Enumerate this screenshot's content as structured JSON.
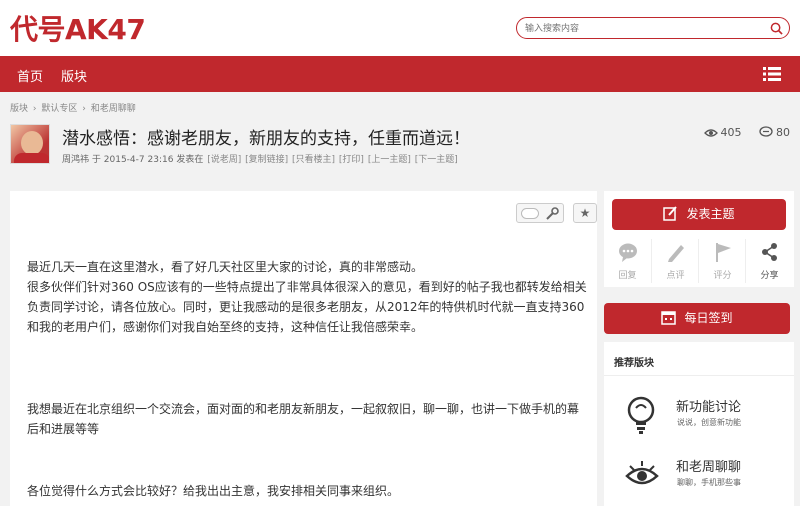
{
  "header": {
    "logo": "代号AK47",
    "search_placeholder": "输入搜索内容"
  },
  "nav": {
    "items": [
      "首页",
      "版块"
    ]
  },
  "breadcrumb": [
    "版块",
    "›",
    "默认专区",
    "›",
    "和老周聊聊"
  ],
  "thread": {
    "title": "潜水感悟：感谢老朋友，新朋友的支持，任重而道远！",
    "author": "周鸿祎",
    "at": "于",
    "date": "2015-4-7 23:16",
    "posted_in": "发表在",
    "forum_link": "[说老周]",
    "links": [
      "[复制链接]",
      "[只看楼主]",
      "[打印]",
      "[上一主题]",
      "[下一主题]"
    ],
    "views": "405",
    "replies": "80"
  },
  "post": {
    "paragraph1": "最近几天一直在这里潜水，看了好几天社区里大家的讨论，真的非常感动。\n很多伙伴们针对360 OS应该有的一些特点提出了非常具体很深入的意见，看到好的帖子我也都转发给相关负责同学讨论，请各位放心。同时，更让我感动的是很多老朋友，从2012年的特供机时代就一直支持360和我的老用户们，感谢你们对我自始至终的支持，这种信任让我倍感荣幸。",
    "paragraph2": "我想最近在北京组织一个交流会，面对面的和老朋友新朋友，一起叙叙旧，聊一聊，也讲一下做手机的幕后和进展等等",
    "paragraph3": "各位觉得什么方式会比较好？给我出出主意，我安排相关同事来组织。",
    "star_glyph": "★"
  },
  "sidebar": {
    "post_button": "发表主题",
    "actions": [
      "回复",
      "点评",
      "评分",
      "分享"
    ],
    "signin_button": "每日签到",
    "recommend_title": "推荐版块",
    "forums": [
      {
        "name": "新功能讨论",
        "desc": "说说，创意新功能"
      },
      {
        "name": "和老周聊聊",
        "desc": "聊聊，手机那些事"
      }
    ]
  },
  "colors": {
    "brand": "#c0282d"
  }
}
